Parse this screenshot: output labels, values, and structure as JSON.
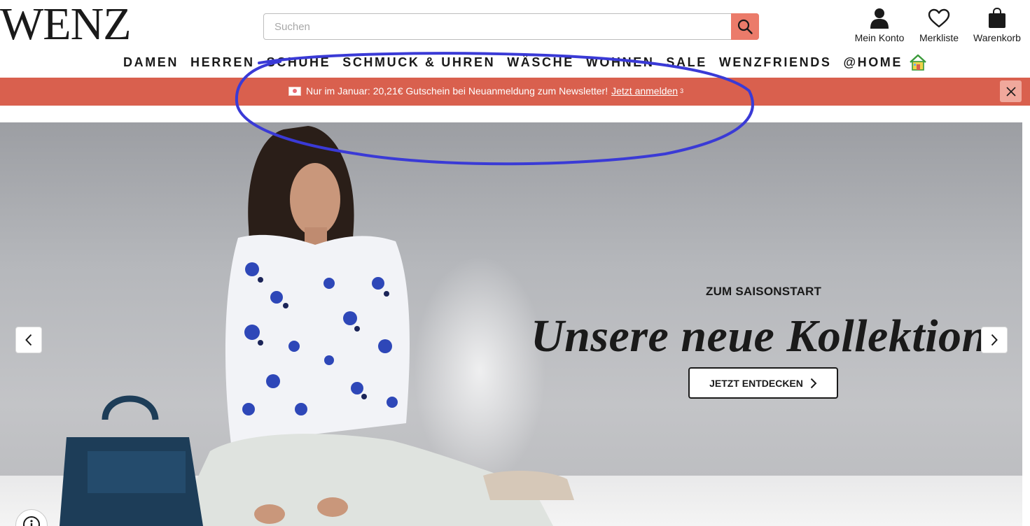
{
  "header": {
    "logo": "WENZ",
    "search": {
      "placeholder": "Suchen",
      "icon": "search-icon"
    },
    "account_label": "Mein Konto",
    "wishlist_label": "Merkliste",
    "cart_label": "Warenkorb"
  },
  "nav": {
    "items": [
      "DAMEN",
      "HERREN",
      "SCHUHE",
      "SCHMUCK & UHREN",
      "WÄSCHE",
      "WOHNEN",
      "SALE",
      "WENZFRIENDS",
      "@HOME"
    ],
    "home_icon": "house-icon"
  },
  "promo": {
    "text": "Nur im Januar: 20,21€ Gutschein bei Neuanmeldung zum Newsletter!",
    "link": "Jetzt anmelden",
    "footnote": "3",
    "background": "#d9604e"
  },
  "hero": {
    "subtitle": "ZUM SAISONSTART",
    "headline": "Unsere neue Kollektion",
    "cta": "JETZT ENTDECKEN"
  },
  "colors": {
    "accent": "#eb7b6a",
    "annotation": "#3a3ad6"
  }
}
